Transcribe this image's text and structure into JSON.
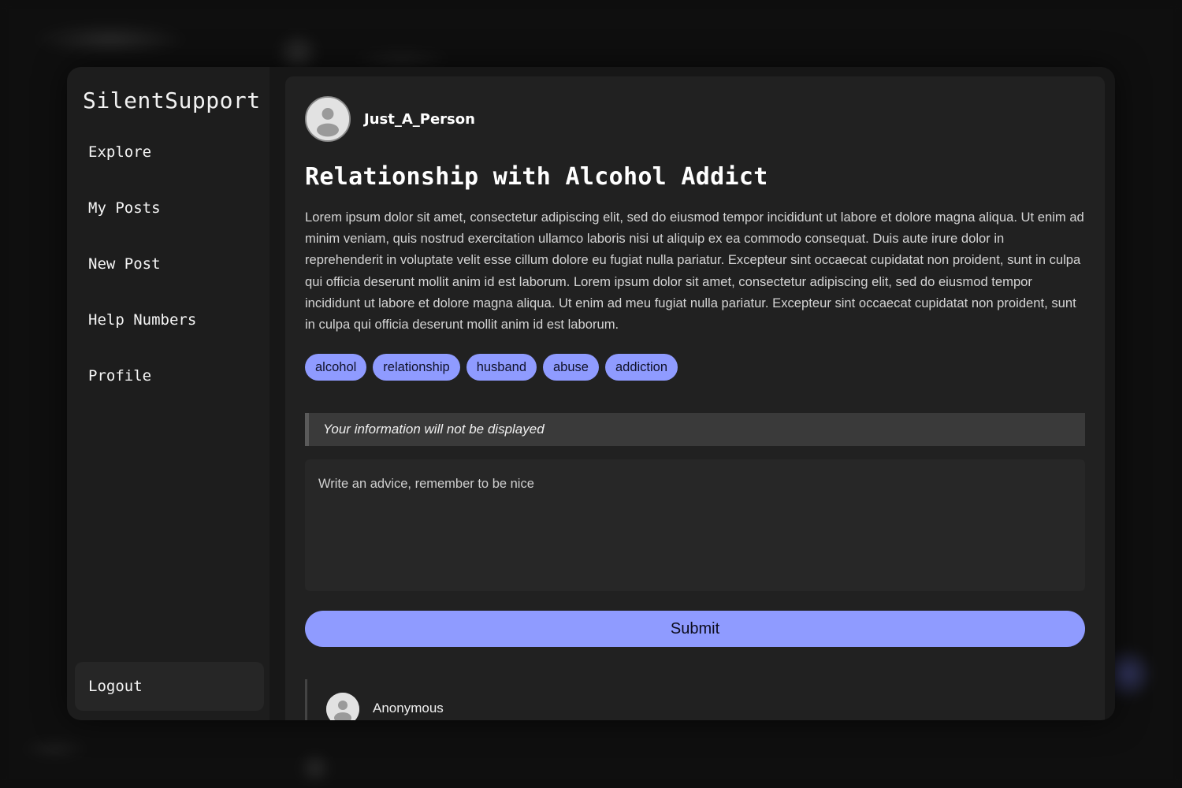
{
  "app": {
    "brand": "SilentSupport"
  },
  "sidebar": {
    "items": [
      {
        "label": "Explore"
      },
      {
        "label": "My Posts"
      },
      {
        "label": "New Post"
      },
      {
        "label": "Help Numbers"
      },
      {
        "label": "Profile"
      }
    ],
    "logout_label": "Logout"
  },
  "post": {
    "author": "Just_A_Person",
    "avatar_icon": "user-avatar-icon",
    "title": "Relationship with Alcohol Addict",
    "body": "Lorem ipsum dolor sit amet, consectetur adipiscing elit, sed do eiusmod tempor incididunt ut labore et dolore magna aliqua. Ut enim ad minim veniam, quis nostrud exercitation ullamco laboris nisi ut aliquip ex ea commodo consequat. Duis aute irure dolor in reprehenderit in voluptate velit esse cillum dolore eu fugiat nulla pariatur. Excepteur sint occaecat cupidatat non proident, sunt in culpa qui officia deserunt mollit anim id est laborum. Lorem ipsum dolor sit amet, consectetur adipiscing elit, sed do eiusmod tempor incididunt ut labore et dolore magna aliqua. Ut enim ad meu fugiat nulla pariatur. Excepteur sint occaecat cupidatat non proident, sunt in culpa qui officia deserunt mollit anim id est laborum.",
    "tags": [
      "alcohol",
      "relationship",
      "husband",
      "abuse",
      "addiction"
    ]
  },
  "reply": {
    "notice": "Your information will not be displayed",
    "placeholder": "Write an advice, remember to be nice",
    "submit_label": "Submit"
  },
  "comments": [
    {
      "author": "Anonymous"
    }
  ],
  "colors": {
    "accent": "#8f9bff",
    "background": "#171717",
    "card": "#212121",
    "sidebar": "#1d1d1d"
  }
}
